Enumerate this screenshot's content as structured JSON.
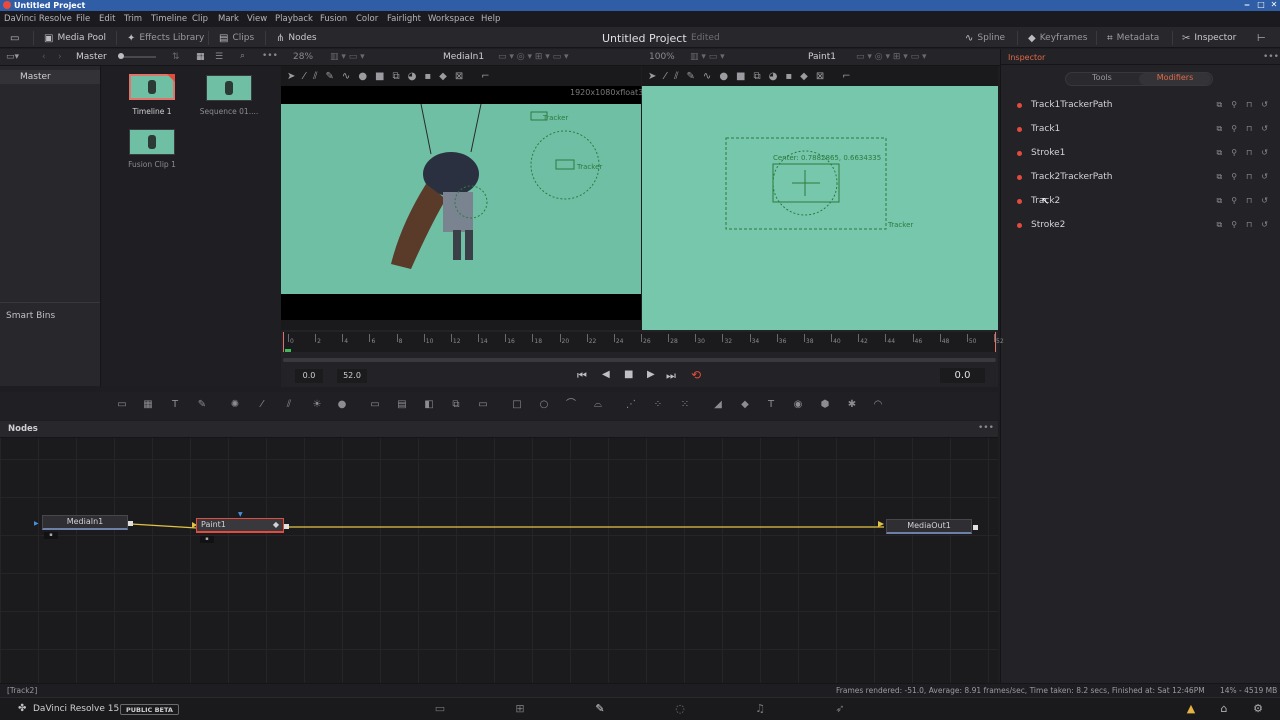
{
  "window": {
    "title": "Untitled Project"
  },
  "menu": [
    "DaVinci Resolve",
    "File",
    "Edit",
    "Trim",
    "Timeline",
    "Clip",
    "Mark",
    "View",
    "Playback",
    "Fusion",
    "Color",
    "Fairlight",
    "Workspace",
    "Help"
  ],
  "toolbar": {
    "media_pool": "Media Pool",
    "effects_library": "Effects Library",
    "clips": "Clips",
    "nodes": "Nodes",
    "project_title": "Untitled Project",
    "project_status": "Edited",
    "spline": "Spline",
    "keyframes": "Keyframes",
    "metadata": "Metadata",
    "inspector": "Inspector"
  },
  "media_pool": {
    "breadcrumb": "Master",
    "bins_master": "Master",
    "smart_bins": "Smart Bins",
    "clips": [
      {
        "label": "Timeline 1"
      },
      {
        "label": "Sequence 01...."
      },
      {
        "label": "Fusion Clip 1"
      }
    ]
  },
  "viewer_left": {
    "zoom": "28%",
    "name": "MediaIn1",
    "resolution": "1920x1080xfloat32",
    "tracker_labels": [
      "Tracker",
      "Tracker"
    ]
  },
  "viewer_right": {
    "zoom": "100%",
    "name": "Paint1",
    "center_text": "Center: 0.7882865, 0.6634335",
    "tracker_label": "Tracker"
  },
  "timeline": {
    "ticks": [
      "0",
      "2",
      "4",
      "6",
      "8",
      "10",
      "12",
      "14",
      "16",
      "18",
      "20",
      "22",
      "24",
      "26",
      "28",
      "30",
      "32",
      "34",
      "36",
      "38",
      "40",
      "42",
      "44",
      "46",
      "48",
      "50",
      "52"
    ],
    "start": "0.0",
    "end": "52.0",
    "current": "0.0"
  },
  "nodes_panel": {
    "title": "Nodes",
    "nodes": [
      {
        "name": "MediaIn1"
      },
      {
        "name": "Paint1"
      },
      {
        "name": "MediaOut1"
      }
    ]
  },
  "inspector": {
    "title": "Inspector",
    "tabs": [
      "Tools",
      "Modifiers"
    ],
    "active_tab": "Modifiers",
    "modifiers": [
      {
        "name": "Track1TrackerPath"
      },
      {
        "name": "Track1"
      },
      {
        "name": "Stroke1"
      },
      {
        "name": "Track2TrackerPath"
      },
      {
        "name": "Track2"
      },
      {
        "name": "Stroke2"
      }
    ]
  },
  "status": {
    "left": "[Track2]",
    "render": "Frames rendered: -51.0,  Average: 8.91 frames/sec,  Time taken: 8.2 secs,  Finished at: Sat 12:46PM",
    "memory": "14% - 4519 MB"
  },
  "footer": {
    "app": "DaVinci Resolve 15",
    "badge": "PUBLIC BETA"
  },
  "colors": {
    "accent_red": "#e54b3c",
    "title_blue": "#2f5ea6",
    "green_screen": "#6fbfa5",
    "connector_yellow": "#e4c341"
  }
}
